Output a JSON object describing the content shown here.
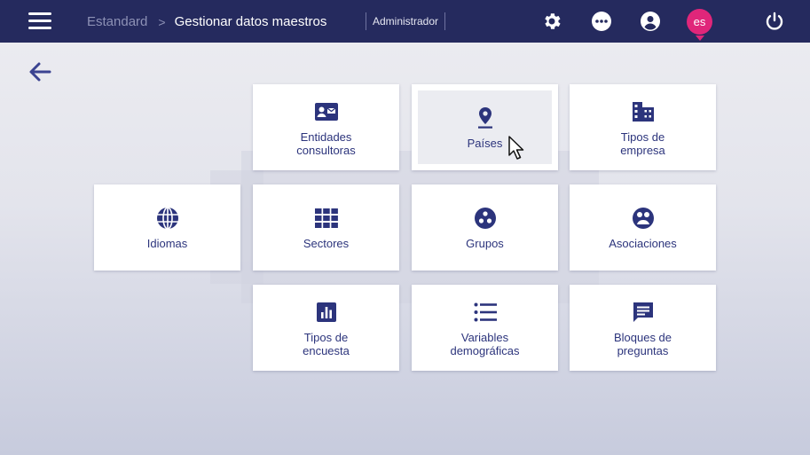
{
  "topbar": {
    "breadcrumb_root": "Estandard",
    "breadcrumb_separator": ">",
    "breadcrumb_current": "Gestionar datos maestros",
    "role": "Administrador",
    "avatar_label": "es",
    "icons": [
      "menu-icon",
      "settings-icon",
      "more-icon",
      "account-icon",
      "power-icon"
    ],
    "colors": {
      "bar": "#252a5e",
      "avatar": "#e0267a"
    }
  },
  "navigation": {
    "back_icon": "arrow-left-icon"
  },
  "tiles": [
    {
      "label": "Entidades\nconsultoras",
      "icon": "contact-card-icon"
    },
    {
      "label": "Países",
      "icon": "map-pin-icon"
    },
    {
      "label": "Tipos de\nempresa",
      "icon": "building-icon"
    },
    {
      "label": "Idiomas",
      "icon": "globe-icon"
    },
    {
      "label": "Sectores",
      "icon": "grid-icon"
    },
    {
      "label": "Grupos",
      "icon": "group-icon"
    },
    {
      "label": "Asociaciones",
      "icon": "associations-icon"
    },
    {
      "label": "Tipos de\nencuesta",
      "icon": "bar-chart-icon"
    },
    {
      "label": "Variables\ndemográficas",
      "icon": "list-icon"
    },
    {
      "label": "Bloques de\npreguntas",
      "icon": "comment-icon"
    }
  ],
  "accent_color": "#2c347c"
}
